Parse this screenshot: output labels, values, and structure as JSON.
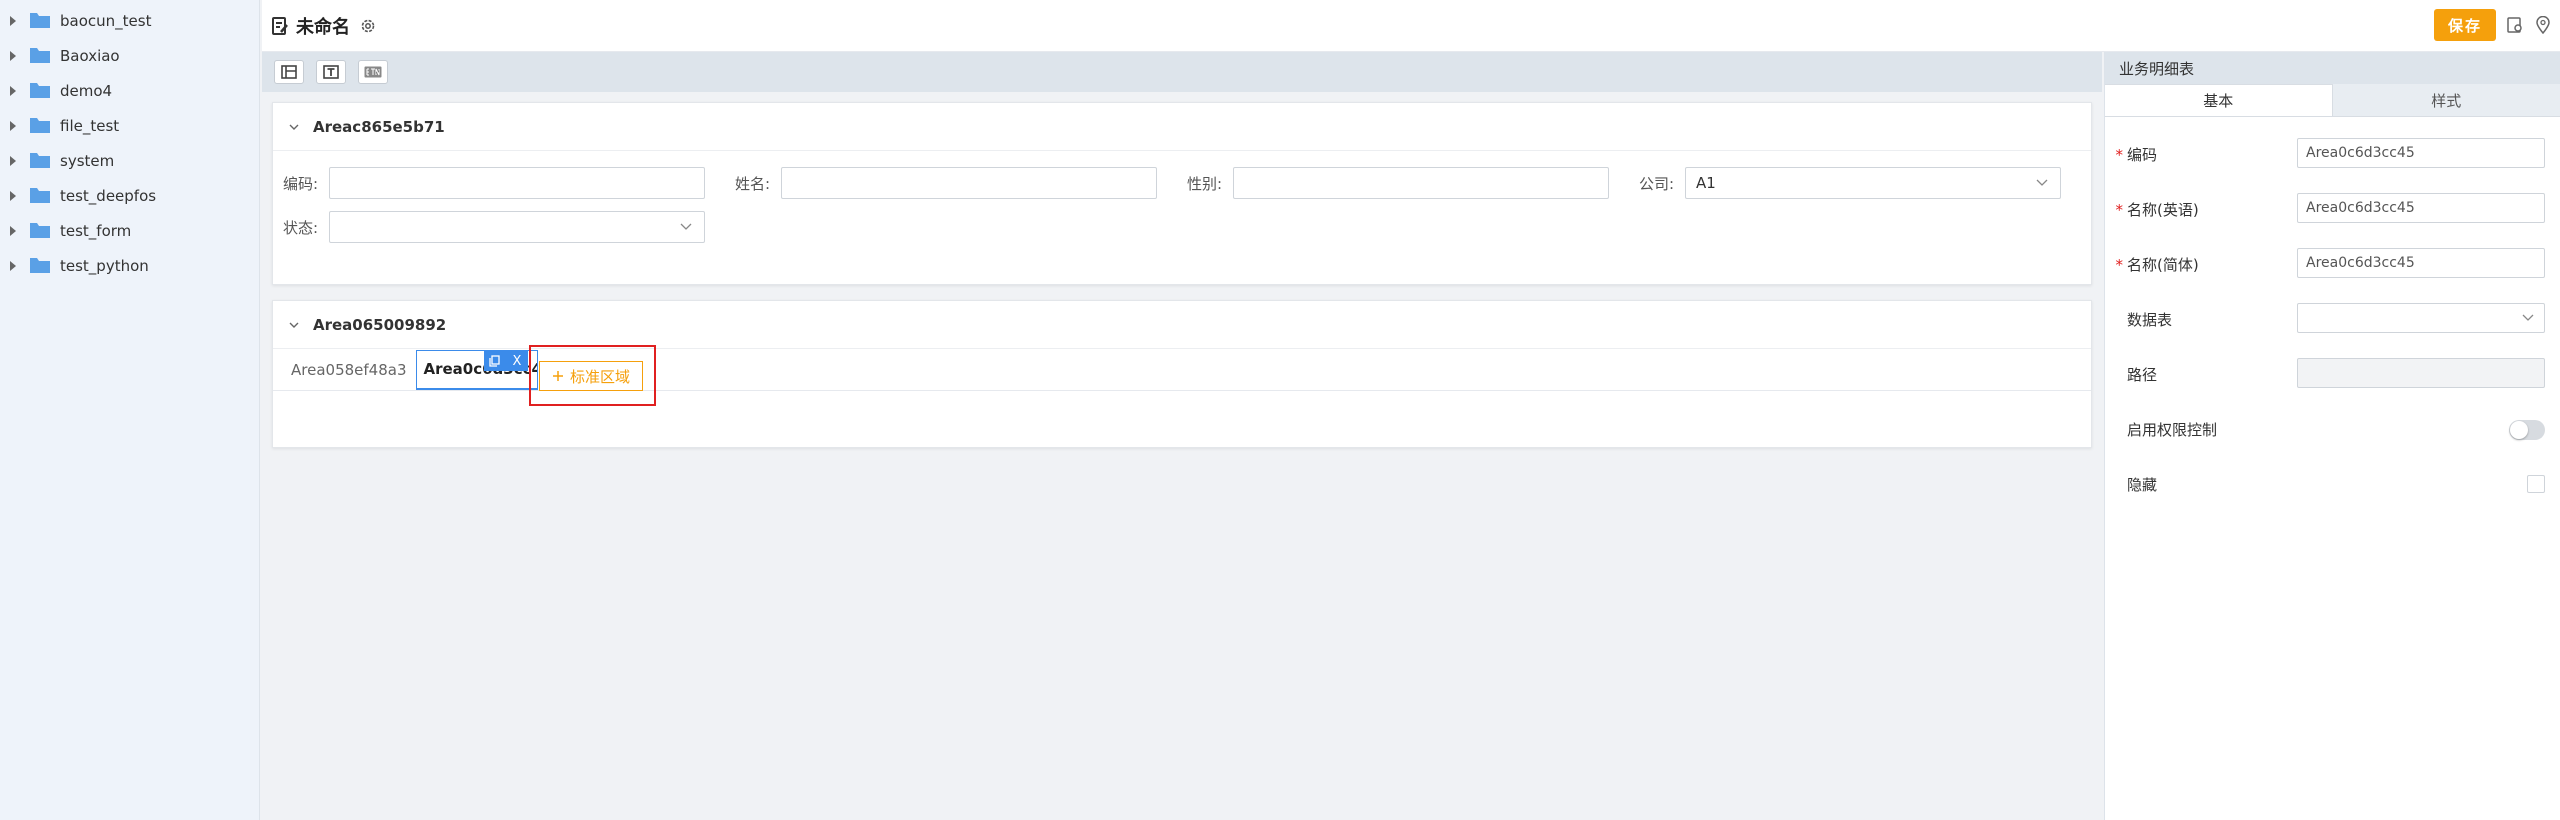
{
  "sidebar": {
    "items": [
      {
        "label": "baocun_test"
      },
      {
        "label": "Baoxiao"
      },
      {
        "label": "demo4"
      },
      {
        "label": "file_test"
      },
      {
        "label": "system"
      },
      {
        "label": "test_deepfos"
      },
      {
        "label": "test_form"
      },
      {
        "label": "test_python"
      }
    ]
  },
  "header": {
    "title": "未命名",
    "save_label": "保存"
  },
  "canvas": {
    "card1": {
      "title": "Areac865e5b71",
      "fields": [
        {
          "label": "编码:",
          "value": ""
        },
        {
          "label": "姓名:",
          "value": ""
        },
        {
          "label": "性别:",
          "value": ""
        },
        {
          "label": "公司:",
          "value": "A1"
        },
        {
          "label": "状态:",
          "value": ""
        }
      ]
    },
    "card2": {
      "title": "Area065009892",
      "tab_inactive": "Area058ef48a3",
      "tab_active": "Area0c6d3cc45",
      "tool_close": "X",
      "add_area_label": "标准区域"
    }
  },
  "panel": {
    "title": "业务明细表",
    "tabs": [
      "基本",
      "样式"
    ],
    "props": [
      {
        "label": "编码",
        "value": "Area0c6d3cc45",
        "required": "*"
      },
      {
        "label": "名称(英语)",
        "value": "Area0c6d3cc45",
        "required": "*"
      },
      {
        "label": "名称(简体)",
        "value": "Area0c6d3cc45",
        "required": "*"
      },
      {
        "label": "数据表",
        "value": ""
      },
      {
        "label": "路径",
        "value": ""
      },
      {
        "label": "启用权限控制"
      },
      {
        "label": "隐藏"
      }
    ]
  },
  "colors": {
    "accent": "#f5a00c",
    "active_blue": "#3b8bea",
    "highlight_red": "#e02020",
    "folder": "#5aa0e6"
  }
}
